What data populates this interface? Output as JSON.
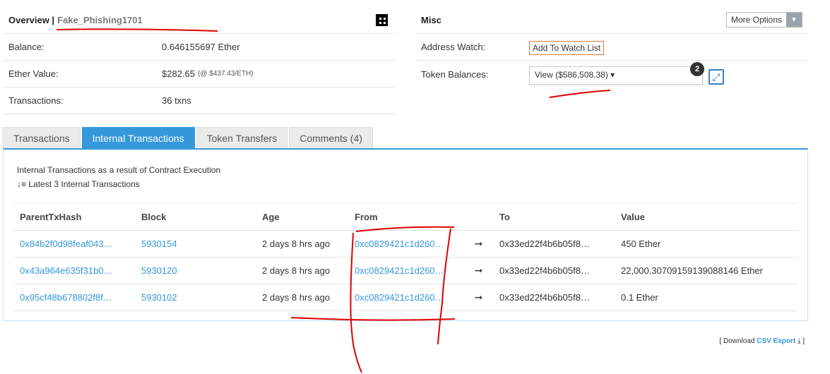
{
  "overview": {
    "title": "Overview |",
    "address_name": "Fake_Phishing1701",
    "rows": [
      {
        "label": "Balance:",
        "value": "0.646155697 Ether",
        "extra": ""
      },
      {
        "label": "Ether Value:",
        "value": "$282.65",
        "extra": "(@ $437.43/ETH)"
      },
      {
        "label": "Transactions:",
        "value": "36 txns",
        "extra": ""
      }
    ]
  },
  "misc": {
    "title": "Misc",
    "more_options": "More Options",
    "address_watch_label": "Address Watch:",
    "add_watch_button": "Add To Watch List",
    "token_balances_label": "Token Balances:",
    "token_select": "View ($586,508.38) ▾",
    "token_count": "2"
  },
  "tabs": [
    {
      "label": "Transactions"
    },
    {
      "label": "Internal Transactions"
    },
    {
      "label": "Token Transfers"
    },
    {
      "label": "Comments (4)"
    }
  ],
  "internal": {
    "description": "Internal Transactions as a result of Contract Execution",
    "latest": "Latest 3 Internal Transactions",
    "columns": [
      "ParentTxHash",
      "Block",
      "Age",
      "From",
      "",
      "To",
      "Value"
    ],
    "rows": [
      {
        "hash": "0x84b2f0d98feaf043…",
        "block": "5930154",
        "age": "2 days 8 hrs ago",
        "from": "0xc0829421c1d260…",
        "arrow": "➞",
        "to": "0x33ed22f4b6b05f8…",
        "value": "450 Ether"
      },
      {
        "hash": "0x43a964e635f31b0…",
        "block": "5930120",
        "age": "2 days 8 hrs ago",
        "from": "0xc0829421c1d260…",
        "arrow": "➞",
        "to": "0x33ed22f4b6b05f8…",
        "value": "22,000.30709159139088146 Ether"
      },
      {
        "hash": "0x95cf48b678802f8f…",
        "block": "5930102",
        "age": "2 days 8 hrs ago",
        "from": "0xc0829421c1d260…",
        "arrow": "➞",
        "to": "0x33ed22f4b6b05f8…",
        "value": "0.1 Ether"
      }
    ]
  },
  "download": {
    "prefix": "[ Download",
    "link": "CSV Export",
    "suffix": "]"
  },
  "colors": {
    "accent": "#3498db",
    "annotation": "#e00000",
    "watch_border": "#e07b39"
  }
}
